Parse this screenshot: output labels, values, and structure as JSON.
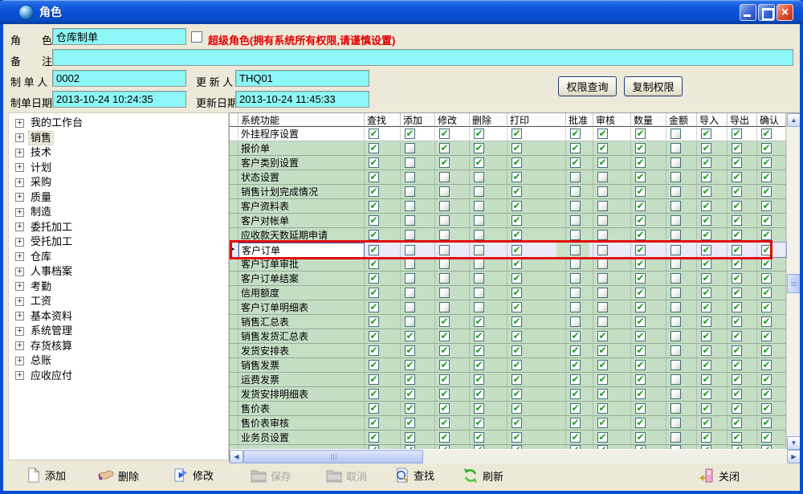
{
  "window": {
    "title": "角色"
  },
  "form": {
    "role_label": "角　　色",
    "role_value": "仓库制单",
    "super_role_label": "超级角色(拥有系统所有权限,请谨慎设置)",
    "remark_label": "备　　注",
    "remark_value": "",
    "creator_label": "制 单 人",
    "creator_value": "0002",
    "updater_label": "更 新 人",
    "updater_value": "THQ01",
    "create_date_label": "制单日期",
    "create_date_value": "2013-10-24 10:24:35",
    "update_date_label": "更新日期",
    "update_date_value": "2013-10-24 11:45:33",
    "perm_query_button": "权限查询",
    "copy_perm_button": "复制权限"
  },
  "tree": {
    "items": [
      {
        "label": "我的工作台",
        "selected": false
      },
      {
        "label": "销售",
        "selected": true
      },
      {
        "label": "技术",
        "selected": false
      },
      {
        "label": "计划",
        "selected": false
      },
      {
        "label": "采购",
        "selected": false
      },
      {
        "label": "质量",
        "selected": false
      },
      {
        "label": "制造",
        "selected": false
      },
      {
        "label": "委托加工",
        "selected": false
      },
      {
        "label": "受托加工",
        "selected": false
      },
      {
        "label": "仓库",
        "selected": false
      },
      {
        "label": "人事档案",
        "selected": false
      },
      {
        "label": "考勤",
        "selected": false
      },
      {
        "label": "工资",
        "selected": false
      },
      {
        "label": "基本资料",
        "selected": false
      },
      {
        "label": "系统管理",
        "selected": false
      },
      {
        "label": "存货核算",
        "selected": false
      },
      {
        "label": "总账",
        "selected": false
      },
      {
        "label": "应收应付",
        "selected": false
      }
    ]
  },
  "table": {
    "columns": [
      "系统功能",
      "查找",
      "添加",
      "修改",
      "删除",
      "打印",
      "批准",
      "审核",
      "数量",
      "金额",
      "导入",
      "导出",
      "确认"
    ],
    "rows": [
      {
        "name": "外挂程序设置",
        "selected": false,
        "checks": [
          1,
          1,
          1,
          1,
          1,
          1,
          1,
          1,
          0,
          1,
          1,
          1
        ]
      },
      {
        "name": "报价单",
        "selected": false,
        "checks": [
          1,
          0,
          1,
          1,
          1,
          1,
          1,
          1,
          0,
          1,
          1,
          1
        ]
      },
      {
        "name": "客户类别设置",
        "selected": false,
        "checks": [
          1,
          0,
          1,
          1,
          1,
          1,
          1,
          1,
          0,
          1,
          1,
          1
        ]
      },
      {
        "name": "状态设置",
        "selected": false,
        "checks": [
          1,
          0,
          0,
          0,
          1,
          0,
          0,
          1,
          0,
          1,
          1,
          1
        ]
      },
      {
        "name": "销售计划完成情况",
        "selected": false,
        "checks": [
          1,
          0,
          0,
          0,
          1,
          0,
          0,
          1,
          0,
          1,
          1,
          1
        ]
      },
      {
        "name": "客户资料表",
        "selected": false,
        "checks": [
          1,
          0,
          0,
          0,
          1,
          0,
          0,
          1,
          0,
          1,
          1,
          1
        ]
      },
      {
        "name": "客户对帐单",
        "selected": false,
        "checks": [
          1,
          0,
          0,
          0,
          1,
          0,
          0,
          1,
          0,
          1,
          1,
          1
        ]
      },
      {
        "name": "应收款天数延期申请",
        "selected": false,
        "checks": [
          1,
          0,
          0,
          0,
          1,
          0,
          0,
          1,
          0,
          1,
          1,
          1
        ]
      },
      {
        "name": "客户订单",
        "selected": true,
        "checks": [
          1,
          0,
          0,
          0,
          1,
          0,
          0,
          1,
          0,
          1,
          1,
          1
        ]
      },
      {
        "name": "客户订单审批",
        "selected": false,
        "checks": [
          1,
          0,
          0,
          0,
          1,
          0,
          0,
          1,
          0,
          1,
          1,
          1
        ]
      },
      {
        "name": "客户订单结案",
        "selected": false,
        "checks": [
          1,
          0,
          0,
          0,
          1,
          0,
          0,
          1,
          0,
          1,
          1,
          1
        ]
      },
      {
        "name": "信用额度",
        "selected": false,
        "checks": [
          1,
          0,
          0,
          0,
          1,
          0,
          0,
          1,
          0,
          1,
          1,
          1
        ]
      },
      {
        "name": "客户订单明细表",
        "selected": false,
        "checks": [
          1,
          0,
          0,
          0,
          1,
          0,
          0,
          1,
          0,
          1,
          1,
          1
        ]
      },
      {
        "name": "销售汇总表",
        "selected": false,
        "checks": [
          1,
          0,
          1,
          1,
          1,
          0,
          0,
          1,
          0,
          1,
          1,
          1
        ]
      },
      {
        "name": "销售发货汇总表",
        "selected": false,
        "checks": [
          1,
          1,
          1,
          1,
          1,
          1,
          1,
          1,
          0,
          1,
          1,
          1
        ]
      },
      {
        "name": "发货安排表",
        "selected": false,
        "checks": [
          1,
          1,
          1,
          1,
          1,
          1,
          1,
          1,
          0,
          1,
          1,
          1
        ]
      },
      {
        "name": "销售发票",
        "selected": false,
        "checks": [
          1,
          1,
          1,
          1,
          1,
          1,
          1,
          1,
          0,
          1,
          1,
          1
        ]
      },
      {
        "name": "运费发票",
        "selected": false,
        "checks": [
          1,
          1,
          1,
          1,
          1,
          1,
          1,
          1,
          0,
          1,
          1,
          1
        ]
      },
      {
        "name": "发货安排明细表",
        "selected": false,
        "checks": [
          1,
          1,
          1,
          1,
          1,
          1,
          1,
          1,
          0,
          1,
          1,
          1
        ]
      },
      {
        "name": "售价表",
        "selected": false,
        "checks": [
          1,
          1,
          1,
          1,
          1,
          1,
          1,
          1,
          0,
          1,
          1,
          1
        ]
      },
      {
        "name": "售价表审核",
        "selected": false,
        "checks": [
          1,
          1,
          1,
          1,
          1,
          1,
          1,
          1,
          0,
          1,
          1,
          1
        ]
      },
      {
        "name": "业务员设置",
        "selected": false,
        "checks": [
          1,
          1,
          1,
          1,
          1,
          1,
          1,
          1,
          0,
          1,
          1,
          1
        ]
      },
      {
        "name": "",
        "selected": false,
        "partial": true,
        "checks": [
          1,
          1,
          1,
          1,
          1,
          1,
          1,
          1,
          0,
          1,
          1,
          1
        ]
      }
    ]
  },
  "toolbar": {
    "buttons": [
      {
        "label": "添加",
        "icon": "add-icon",
        "enabled": true
      },
      {
        "label": "删除",
        "icon": "delete-icon",
        "enabled": true
      },
      {
        "label": "修改",
        "icon": "modify-icon",
        "enabled": true
      },
      {
        "label": "保存",
        "icon": "save-icon",
        "enabled": false
      },
      {
        "label": "取消",
        "icon": "cancel-icon",
        "enabled": false
      },
      {
        "label": "查找",
        "icon": "find-icon",
        "enabled": true
      },
      {
        "label": "刷新",
        "icon": "refresh-icon",
        "enabled": true
      },
      {
        "label": "关闭",
        "icon": "exit-icon",
        "enabled": true
      }
    ]
  },
  "colors": {
    "titlebar_blue": "#0a4fd2",
    "panel_beige": "#ece9d8",
    "input_cyan": "#8df6f6",
    "row_green": "#c5dfc5",
    "selected_row_lavender": "#eaeaf8",
    "warning_red": "#e00000",
    "selection_frame_red": "#e10707",
    "check_green": "#1f9e1f"
  }
}
